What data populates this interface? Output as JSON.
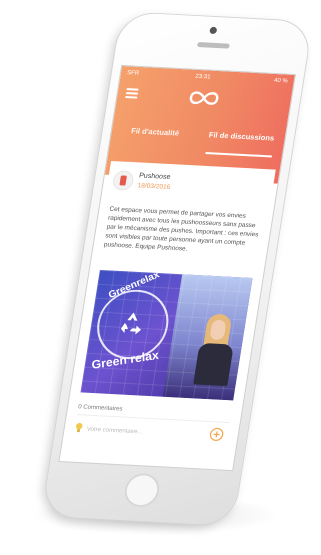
{
  "status_bar": {
    "carrier": "SFR",
    "time": "23:31",
    "battery": "40 %"
  },
  "header": {
    "menu_icon": "hamburger-menu-icon",
    "logo_icon": "infinity-logo-icon"
  },
  "tabs": [
    {
      "label": "Fil d'actualité",
      "active": false
    },
    {
      "label": "Fil de discussions",
      "active": true
    }
  ],
  "post": {
    "author": "Pushoose",
    "date": "18/03/2016",
    "body": "Cet espace vous permet de partager vos envies rapidement avec tous les pushoosseurs sans passe par le mécanisme des pushes. Important : ces envies sont visibles par toute personne ayant un compte pushoose. Equipe Pushoose.",
    "media_text_top": "Greenrelax",
    "media_text_bottom": "Green relax",
    "comments_count": "0 Commentaires",
    "comment_placeholder": "Votre commentaire..."
  },
  "colors": {
    "header_start": "#f5a16b",
    "header_end": "#ef6d5f",
    "date": "#f09a55"
  }
}
